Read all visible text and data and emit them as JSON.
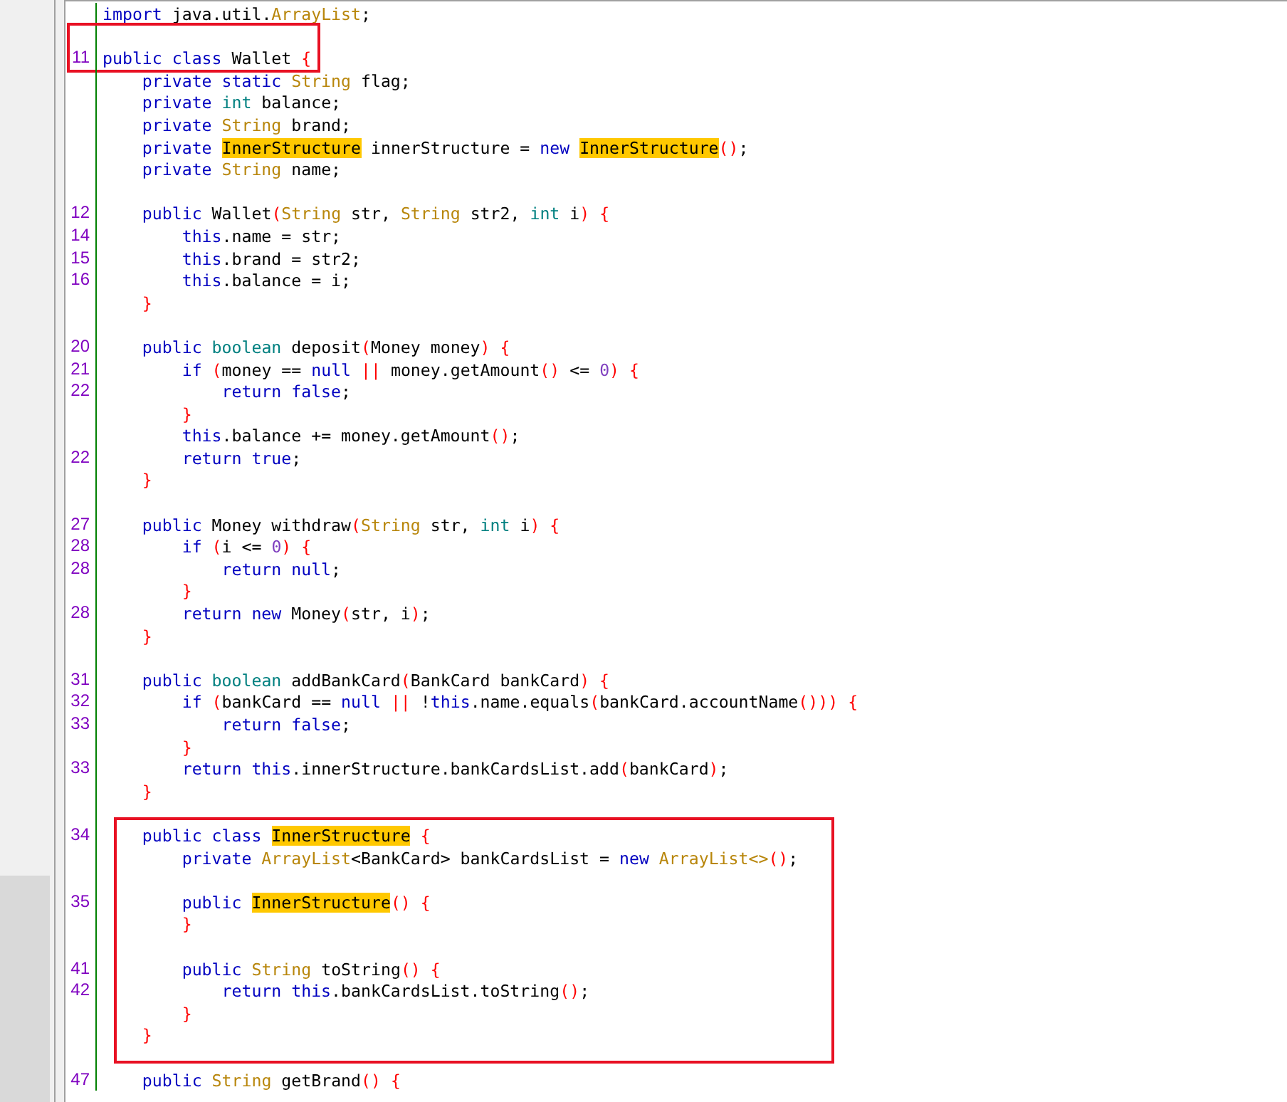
{
  "editor": {
    "blocks": [
      {
        "boxed": false,
        "lines": [
          {
            "kind": "code",
            "tokens": [
              {
                "kind": "keyword",
                "text": "import"
              },
              {
                "kind": "plain",
                "text": " java.util."
              },
              {
                "kind": "type",
                "text": "ArrayList"
              },
              {
                "kind": "plain",
                "text": ";"
              }
            ]
          },
          {
            "kind": "blank"
          }
        ]
      },
      {
        "boxed": true,
        "lines": [
          {
            "kind": "code",
            "number": "11",
            "tokens": [
              {
                "kind": "keyword",
                "text": "public class"
              },
              {
                "kind": "plain",
                "text": " Wallet "
              },
              {
                "kind": "bracket",
                "text": "{"
              }
            ]
          }
        ]
      },
      {
        "boxed": false,
        "lines": [
          {
            "kind": "code",
            "tokens": [
              {
                "kind": "keyword",
                "text": "    private static"
              },
              {
                "kind": "type",
                "text": " String"
              },
              {
                "kind": "plain",
                "text": " flag;"
              }
            ]
          },
          {
            "kind": "code",
            "tokens": [
              {
                "kind": "keyword",
                "text": "    private"
              },
              {
                "kind": "primitive",
                "text": " int"
              },
              {
                "kind": "plain",
                "text": " balance;"
              }
            ]
          },
          {
            "kind": "code",
            "tokens": [
              {
                "kind": "keyword",
                "text": "    private"
              },
              {
                "kind": "type",
                "text": " String"
              },
              {
                "kind": "plain",
                "text": " brand;"
              }
            ]
          },
          {
            "kind": "code",
            "tokens": [
              {
                "kind": "keyword",
                "text": "    private "
              },
              {
                "kind": "highlight",
                "text": "InnerStructure"
              },
              {
                "kind": "plain",
                "text": " innerStructure = "
              },
              {
                "kind": "keyword",
                "text": "new "
              },
              {
                "kind": "highlight",
                "text": "InnerStructure"
              },
              {
                "kind": "bracket",
                "text": "()"
              },
              {
                "kind": "plain",
                "text": ";"
              }
            ]
          },
          {
            "kind": "code",
            "tokens": [
              {
                "kind": "keyword",
                "text": "    private"
              },
              {
                "kind": "type",
                "text": " String"
              },
              {
                "kind": "plain",
                "text": " name;"
              }
            ]
          },
          {
            "kind": "blank"
          },
          {
            "kind": "code",
            "number": "12",
            "tokens": [
              {
                "kind": "keyword",
                "text": "    public"
              },
              {
                "kind": "plain",
                "text": " Wallet"
              },
              {
                "kind": "bracket",
                "text": "("
              },
              {
                "kind": "type",
                "text": "String"
              },
              {
                "kind": "plain",
                "text": " str, "
              },
              {
                "kind": "type",
                "text": "String"
              },
              {
                "kind": "plain",
                "text": " str2, "
              },
              {
                "kind": "primitive",
                "text": "int"
              },
              {
                "kind": "plain",
                "text": " i"
              },
              {
                "kind": "bracket",
                "text": ") {"
              }
            ]
          },
          {
            "kind": "code",
            "number": "14",
            "tokens": [
              {
                "kind": "keyword",
                "text": "        this"
              },
              {
                "kind": "plain",
                "text": ".name = str;"
              }
            ]
          },
          {
            "kind": "code",
            "number": "15",
            "tokens": [
              {
                "kind": "keyword",
                "text": "        this"
              },
              {
                "kind": "plain",
                "text": ".brand = str2;"
              }
            ]
          },
          {
            "kind": "code",
            "number": "16",
            "tokens": [
              {
                "kind": "keyword",
                "text": "        this"
              },
              {
                "kind": "plain",
                "text": ".balance = i;"
              }
            ]
          },
          {
            "kind": "code",
            "tokens": [
              {
                "kind": "bracket",
                "text": "    }"
              }
            ]
          },
          {
            "kind": "blank"
          },
          {
            "kind": "code",
            "number": "20",
            "tokens": [
              {
                "kind": "keyword",
                "text": "    public"
              },
              {
                "kind": "primitive",
                "text": " boolean"
              },
              {
                "kind": "plain",
                "text": " deposit"
              },
              {
                "kind": "bracket",
                "text": "("
              },
              {
                "kind": "plain",
                "text": "Money money"
              },
              {
                "kind": "bracket",
                "text": ") {"
              }
            ]
          },
          {
            "kind": "code",
            "number": "21",
            "tokens": [
              {
                "kind": "keyword",
                "text": "        if"
              },
              {
                "kind": "bracket",
                "text": " ("
              },
              {
                "kind": "plain",
                "text": "money == "
              },
              {
                "kind": "keyword",
                "text": "null"
              },
              {
                "kind": "bracket",
                "text": " ||"
              },
              {
                "kind": "plain",
                "text": " money.getAmount"
              },
              {
                "kind": "bracket",
                "text": "()"
              },
              {
                "kind": "plain",
                "text": " <= "
              },
              {
                "kind": "number",
                "text": "0"
              },
              {
                "kind": "bracket",
                "text": ") {"
              }
            ]
          },
          {
            "kind": "code",
            "number": "22",
            "tokens": [
              {
                "kind": "keyword",
                "text": "            return false"
              },
              {
                "kind": "plain",
                "text": ";"
              }
            ]
          },
          {
            "kind": "code",
            "tokens": [
              {
                "kind": "bracket",
                "text": "        }"
              }
            ]
          },
          {
            "kind": "code",
            "tokens": [
              {
                "kind": "keyword",
                "text": "        this"
              },
              {
                "kind": "plain",
                "text": ".balance += money.getAmount"
              },
              {
                "kind": "bracket",
                "text": "()"
              },
              {
                "kind": "plain",
                "text": ";"
              }
            ]
          },
          {
            "kind": "code",
            "number": "22",
            "tokens": [
              {
                "kind": "keyword",
                "text": "        return true"
              },
              {
                "kind": "plain",
                "text": ";"
              }
            ]
          },
          {
            "kind": "code",
            "tokens": [
              {
                "kind": "bracket",
                "text": "    }"
              }
            ]
          },
          {
            "kind": "blank"
          },
          {
            "kind": "code",
            "number": "27",
            "tokens": [
              {
                "kind": "keyword",
                "text": "    public"
              },
              {
                "kind": "plain",
                "text": " Money withdraw"
              },
              {
                "kind": "bracket",
                "text": "("
              },
              {
                "kind": "type",
                "text": "String"
              },
              {
                "kind": "plain",
                "text": " str, "
              },
              {
                "kind": "primitive",
                "text": "int"
              },
              {
                "kind": "plain",
                "text": " i"
              },
              {
                "kind": "bracket",
                "text": ") {"
              }
            ]
          },
          {
            "kind": "code",
            "number": "28",
            "tokens": [
              {
                "kind": "keyword",
                "text": "        if"
              },
              {
                "kind": "bracket",
                "text": " ("
              },
              {
                "kind": "plain",
                "text": "i <= "
              },
              {
                "kind": "number",
                "text": "0"
              },
              {
                "kind": "bracket",
                "text": ") {"
              }
            ]
          },
          {
            "kind": "code",
            "number": "28",
            "tokens": [
              {
                "kind": "keyword",
                "text": "            return null"
              },
              {
                "kind": "plain",
                "text": ";"
              }
            ]
          },
          {
            "kind": "code",
            "tokens": [
              {
                "kind": "bracket",
                "text": "        }"
              }
            ]
          },
          {
            "kind": "code",
            "number": "28",
            "tokens": [
              {
                "kind": "keyword",
                "text": "        return new"
              },
              {
                "kind": "plain",
                "text": " Money"
              },
              {
                "kind": "bracket",
                "text": "("
              },
              {
                "kind": "plain",
                "text": "str, i"
              },
              {
                "kind": "bracket",
                "text": ")"
              },
              {
                "kind": "plain",
                "text": ";"
              }
            ]
          },
          {
            "kind": "code",
            "tokens": [
              {
                "kind": "bracket",
                "text": "    }"
              }
            ]
          },
          {
            "kind": "blank"
          },
          {
            "kind": "code",
            "number": "31",
            "tokens": [
              {
                "kind": "keyword",
                "text": "    public"
              },
              {
                "kind": "primitive",
                "text": " boolean"
              },
              {
                "kind": "plain",
                "text": " addBankCard"
              },
              {
                "kind": "bracket",
                "text": "("
              },
              {
                "kind": "plain",
                "text": "BankCard bankCard"
              },
              {
                "kind": "bracket",
                "text": ") {"
              }
            ]
          },
          {
            "kind": "code",
            "number": "32",
            "tokens": [
              {
                "kind": "keyword",
                "text": "        if"
              },
              {
                "kind": "bracket",
                "text": " ("
              },
              {
                "kind": "plain",
                "text": "bankCard == "
              },
              {
                "kind": "keyword",
                "text": "null"
              },
              {
                "kind": "bracket",
                "text": " ||"
              },
              {
                "kind": "plain",
                "text": " !"
              },
              {
                "kind": "keyword",
                "text": "this"
              },
              {
                "kind": "plain",
                "text": ".name.equals"
              },
              {
                "kind": "bracket",
                "text": "("
              },
              {
                "kind": "plain",
                "text": "bankCard.accountName"
              },
              {
                "kind": "bracket",
                "text": "())) {"
              }
            ]
          },
          {
            "kind": "code",
            "number": "33",
            "tokens": [
              {
                "kind": "keyword",
                "text": "            return false"
              },
              {
                "kind": "plain",
                "text": ";"
              }
            ]
          },
          {
            "kind": "code",
            "tokens": [
              {
                "kind": "bracket",
                "text": "        }"
              }
            ]
          },
          {
            "kind": "code",
            "number": "33",
            "tokens": [
              {
                "kind": "keyword",
                "text": "        return this"
              },
              {
                "kind": "plain",
                "text": ".innerStructure.bankCardsList.add"
              },
              {
                "kind": "bracket",
                "text": "("
              },
              {
                "kind": "plain",
                "text": "bankCard"
              },
              {
                "kind": "bracket",
                "text": ")"
              },
              {
                "kind": "plain",
                "text": ";"
              }
            ]
          },
          {
            "kind": "code",
            "tokens": [
              {
                "kind": "bracket",
                "text": "    }"
              }
            ]
          },
          {
            "kind": "blank"
          }
        ]
      },
      {
        "boxed": true,
        "lines": [
          {
            "kind": "code",
            "number": "34",
            "tokens": [
              {
                "kind": "keyword",
                "text": "    public class "
              },
              {
                "kind": "highlight",
                "text": "InnerStructure"
              },
              {
                "kind": "bracket",
                "text": " {"
              }
            ]
          },
          {
            "kind": "code",
            "tokens": [
              {
                "kind": "keyword",
                "text": "        private"
              },
              {
                "kind": "type",
                "text": " ArrayList"
              },
              {
                "kind": "plain",
                "text": "<BankCard> bankCardsList = "
              },
              {
                "kind": "keyword",
                "text": "new"
              },
              {
                "kind": "type",
                "text": " ArrayList<>"
              },
              {
                "kind": "bracket",
                "text": "()"
              },
              {
                "kind": "plain",
                "text": ";"
              }
            ]
          },
          {
            "kind": "blank"
          },
          {
            "kind": "code",
            "number": "35",
            "tokens": [
              {
                "kind": "keyword",
                "text": "        public "
              },
              {
                "kind": "highlight",
                "text": "InnerStructure"
              },
              {
                "kind": "bracket",
                "text": "() {"
              }
            ]
          },
          {
            "kind": "code",
            "tokens": [
              {
                "kind": "bracket",
                "text": "        }"
              }
            ]
          },
          {
            "kind": "blank"
          },
          {
            "kind": "code",
            "number": "41",
            "tokens": [
              {
                "kind": "keyword",
                "text": "        public"
              },
              {
                "kind": "type",
                "text": " String"
              },
              {
                "kind": "plain",
                "text": " toString"
              },
              {
                "kind": "bracket",
                "text": "() {"
              }
            ]
          },
          {
            "kind": "code",
            "number": "42",
            "tokens": [
              {
                "kind": "keyword",
                "text": "            return this"
              },
              {
                "kind": "plain",
                "text": ".bankCardsList.toString"
              },
              {
                "kind": "bracket",
                "text": "()"
              },
              {
                "kind": "plain",
                "text": ";"
              }
            ]
          },
          {
            "kind": "code",
            "tokens": [
              {
                "kind": "bracket",
                "text": "        }"
              }
            ]
          },
          {
            "kind": "code",
            "tokens": [
              {
                "kind": "bracket",
                "text": "    }"
              }
            ]
          }
        ]
      },
      {
        "boxed": false,
        "lines": [
          {
            "kind": "blank"
          },
          {
            "kind": "code",
            "number": "47",
            "tokens": [
              {
                "kind": "keyword",
                "text": "    public"
              },
              {
                "kind": "type",
                "text": " String"
              },
              {
                "kind": "plain",
                "text": " getBrand"
              },
              {
                "kind": "bracket",
                "text": "() {"
              }
            ]
          }
        ]
      }
    ]
  }
}
